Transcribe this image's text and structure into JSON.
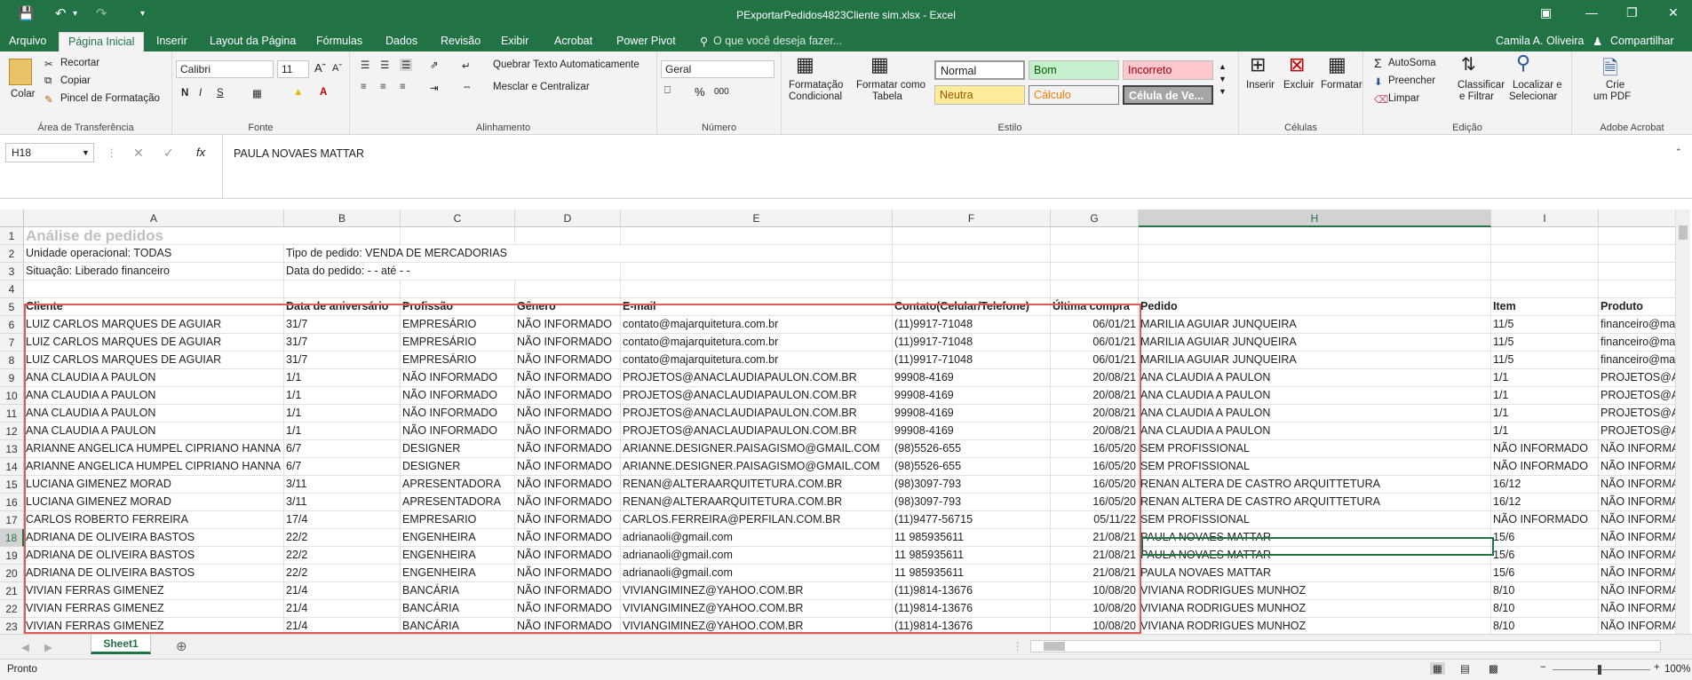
{
  "title": "PExportarPedidos4823Cliente sim.xlsx - Excel",
  "user": "Camila A. Oliveira",
  "share": "Compartilhar",
  "tabs": [
    "Arquivo",
    "Página Inicial",
    "Inserir",
    "Layout da Página",
    "Fórmulas",
    "Dados",
    "Revisão",
    "Exibir",
    "Acrobat",
    "Power Pivot"
  ],
  "tellme": "O que você deseja fazer...",
  "ribbon": {
    "paste": "Colar",
    "cut": "Recortar",
    "copy": "Copiar",
    "painter": "Pincel de Formatação",
    "clipboard": "Área de Transferência",
    "font": "Calibri",
    "size": "11",
    "font_group": "Fonte",
    "bold": "N",
    "italic": "I",
    "underline": "S",
    "wrap": "Quebrar Texto Automaticamente",
    "merge": "Mesclar e Centralizar",
    "align_group": "Alinhamento",
    "numfmt": "Geral",
    "pct": "%",
    "thousands": "000",
    "num_group": "Número",
    "cond1": "Formatação",
    "cond2": "Condicional",
    "fmt1": "Formatar como",
    "fmt2": "Tabela",
    "styles": [
      "Normal",
      "Bom",
      "Incorreto",
      "Neutra",
      "Cálculo",
      "Célula de Ve..."
    ],
    "styles_group": "Estilo",
    "ins": "Inserir",
    "del": "Excluir",
    "fmt": "Formatar",
    "cells_group": "Células",
    "autosum": "AutoSoma",
    "fill": "Preencher",
    "clear": "Limpar",
    "sort1": "Classificar",
    "sort2": "e Filtrar",
    "find1": "Localizar e",
    "find2": "Selecionar",
    "edit_group": "Edição",
    "pdf1": "Crie",
    "pdf2": "um PDF",
    "acro_group": "Adobe Acrobat"
  },
  "namebox": "H18",
  "formula": "PAULA NOVAES MATTAR",
  "columns": [
    "A",
    "B",
    "C",
    "D",
    "E",
    "F",
    "G",
    "H",
    "I",
    ""
  ],
  "rows": [
    "1",
    "2",
    "3",
    "4",
    "5",
    "6",
    "7",
    "8",
    "9",
    "10",
    "11",
    "12",
    "13",
    "14",
    "15",
    "16",
    "17",
    "18",
    "19",
    "20",
    "21",
    "22",
    "23"
  ],
  "sheet": {
    "title": "Análise de pedidos",
    "r2a": "Unidade operacional: TODAS",
    "r2b": "Tipo de pedido: VENDA DE MERCADORIAS",
    "r3a": "Situação: Liberado financeiro",
    "r3b": "Data do pedido:    - -   até    - -",
    "headers": [
      "Cliente",
      "Data de aniversário",
      "Profissão",
      "Gênero",
      "E-mail",
      "Contato(Celular/Telefone)",
      "Última compra",
      "Pedido",
      "Item",
      "Produto"
    ],
    "data": [
      [
        "LUIZ CARLOS MARQUES DE AGUIAR",
        "31/7",
        "EMPRESÁRIO",
        "NÃO INFORMADO",
        "contato@majarquitetura.com.br",
        "(11)9917-71048",
        "06/01/21",
        "MARILIA AGUIAR JUNQUEIRA",
        "11/5",
        "financeiro@majarquitetura.com.br"
      ],
      [
        "LUIZ CARLOS MARQUES DE AGUIAR",
        "31/7",
        "EMPRESÁRIO",
        "NÃO INFORMADO",
        "contato@majarquitetura.com.br",
        "(11)9917-71048",
        "06/01/21",
        "MARILIA AGUIAR JUNQUEIRA",
        "11/5",
        "financeiro@majarquitetura.com.br"
      ],
      [
        "LUIZ CARLOS MARQUES DE AGUIAR",
        "31/7",
        "EMPRESÁRIO",
        "NÃO INFORMADO",
        "contato@majarquitetura.com.br",
        "(11)9917-71048",
        "06/01/21",
        "MARILIA AGUIAR JUNQUEIRA",
        "11/5",
        "financeiro@majarquitetura.com.br"
      ],
      [
        "ANA CLAUDIA A PAULON",
        "1/1",
        "NÃO INFORMADO",
        "NÃO INFORMADO",
        "PROJETOS@ANACLAUDIAPAULON.COM.BR",
        "99908-4169",
        "20/08/21",
        "ANA CLAUDIA A PAULON",
        "1/1",
        "PROJETOS@ANACLAUDIAPAULON.COM.BR"
      ],
      [
        "ANA CLAUDIA A PAULON",
        "1/1",
        "NÃO INFORMADO",
        "NÃO INFORMADO",
        "PROJETOS@ANACLAUDIAPAULON.COM.BR",
        "99908-4169",
        "20/08/21",
        "ANA CLAUDIA A PAULON",
        "1/1",
        "PROJETOS@ANACLAUDIAPAULON.COM.BR"
      ],
      [
        "ANA CLAUDIA A PAULON",
        "1/1",
        "NÃO INFORMADO",
        "NÃO INFORMADO",
        "PROJETOS@ANACLAUDIAPAULON.COM.BR",
        "99908-4169",
        "20/08/21",
        "ANA CLAUDIA A PAULON",
        "1/1",
        "PROJETOS@ANACLAUDIAPAULON.COM.BR"
      ],
      [
        "ANA CLAUDIA A PAULON",
        "1/1",
        "NÃO INFORMADO",
        "NÃO INFORMADO",
        "PROJETOS@ANACLAUDIAPAULON.COM.BR",
        "99908-4169",
        "20/08/21",
        "ANA CLAUDIA A PAULON",
        "1/1",
        "PROJETOS@ANACLAUDIAPAULON.COM.BR"
      ],
      [
        "ARIANNE ANGELICA HUMPEL CIPRIANO HANNA",
        "6/7",
        "DESIGNER",
        "NÃO INFORMADO",
        "ARIANNE.DESIGNER.PAISAGISMO@GMAIL.COM",
        "(98)5526-655",
        "16/05/20",
        "SEM PROFISSIONAL",
        "NÃO INFORMADO",
        "NÃO INFORMADO"
      ],
      [
        "ARIANNE ANGELICA HUMPEL CIPRIANO HANNA",
        "6/7",
        "DESIGNER",
        "NÃO INFORMADO",
        "ARIANNE.DESIGNER.PAISAGISMO@GMAIL.COM",
        "(98)5526-655",
        "16/05/20",
        "SEM PROFISSIONAL",
        "NÃO INFORMADO",
        "NÃO INFORMADO"
      ],
      [
        "LUCIANA GIMENEZ MORAD",
        "3/11",
        "APRESENTADORA",
        "NÃO INFORMADO",
        "RENAN@ALTERAARQUITETURA.COM.BR",
        "(98)3097-793",
        "16/05/20",
        "RENAN ALTERA DE CASTRO ARQUITTETURA",
        "16/12",
        "NÃO INFORMADO"
      ],
      [
        "LUCIANA GIMENEZ MORAD",
        "3/11",
        "APRESENTADORA",
        "NÃO INFORMADO",
        "RENAN@ALTERAARQUITETURA.COM.BR",
        "(98)3097-793",
        "16/05/20",
        "RENAN ALTERA DE CASTRO ARQUITTETURA",
        "16/12",
        "NÃO INFORMADO"
      ],
      [
        "CARLOS ROBERTO FERREIRA",
        "17/4",
        "EMPRESARIO",
        "NÃO INFORMADO",
        "CARLOS.FERREIRA@PERFILAN.COM.BR",
        "(11)9477-56715",
        "05/11/22",
        "SEM PROFISSIONAL",
        "NÃO INFORMADO",
        "NÃO INFORMADO"
      ],
      [
        "ADRIANA DE OLIVEIRA BASTOS",
        "22/2",
        "ENGENHEIRA",
        "NÃO INFORMADO",
        "adrianaoli@gmail.com",
        "11 985935611",
        "21/08/21",
        "PAULA NOVAES MATTAR",
        "15/6",
        "NÃO INFORMADO"
      ],
      [
        "ADRIANA DE OLIVEIRA BASTOS",
        "22/2",
        "ENGENHEIRA",
        "NÃO INFORMADO",
        "adrianaoli@gmail.com",
        "11 985935611",
        "21/08/21",
        "PAULA NOVAES MATTAR",
        "15/6",
        "NÃO INFORMADO"
      ],
      [
        "ADRIANA DE OLIVEIRA BASTOS",
        "22/2",
        "ENGENHEIRA",
        "NÃO INFORMADO",
        "adrianaoli@gmail.com",
        "11 985935611",
        "21/08/21",
        "PAULA NOVAES MATTAR",
        "15/6",
        "NÃO INFORMADO"
      ],
      [
        "VIVIAN FERRAS GIMENEZ",
        "21/4",
        "BANCÁRIA",
        "NÃO INFORMADO",
        "VIVIANGIMINEZ@YAHOO.COM.BR",
        "(11)9814-13676",
        "10/08/20",
        "VIVIANA RODRIGUES MUNHOZ",
        "8/10",
        "NÃO INFORMADO"
      ],
      [
        "VIVIAN FERRAS GIMENEZ",
        "21/4",
        "BANCÁRIA",
        "NÃO INFORMADO",
        "VIVIANGIMINEZ@YAHOO.COM.BR",
        "(11)9814-13676",
        "10/08/20",
        "VIVIANA RODRIGUES MUNHOZ",
        "8/10",
        "NÃO INFORMADO"
      ],
      [
        "VIVIAN FERRAS GIMENEZ",
        "21/4",
        "BANCÁRIA",
        "NÃO INFORMADO",
        "VIVIANGIMINEZ@YAHOO.COM.BR",
        "(11)9814-13676",
        "10/08/20",
        "VIVIANA RODRIGUES MUNHOZ",
        "8/10",
        "NÃO INFORMADO"
      ]
    ]
  },
  "sheet_tab": "Sheet1",
  "status": "Pronto",
  "zoom": "100%",
  "colors": {
    "excel_green": "#217346",
    "selection_border": "#e05a5a"
  }
}
